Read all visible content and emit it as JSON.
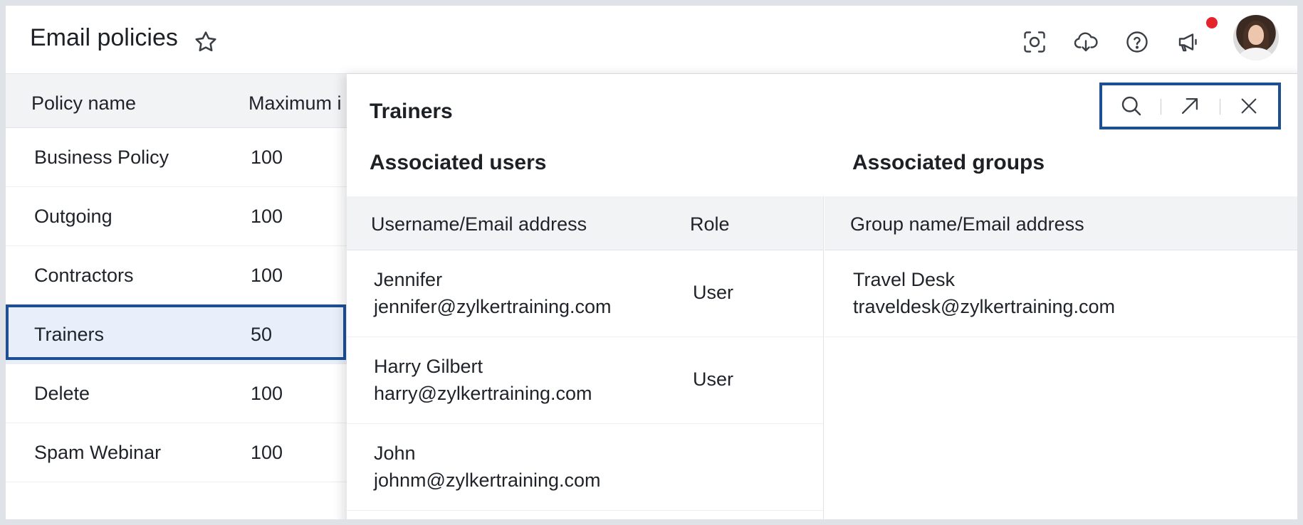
{
  "header": {
    "title": "Email policies",
    "icons": [
      "star-icon",
      "screenshot-icon",
      "cloud-download-icon",
      "help-icon",
      "announcement-icon",
      "avatar"
    ],
    "notification_color": "#e5232d"
  },
  "policies": {
    "columns": [
      "Policy name",
      "Maximum i"
    ],
    "rows": [
      {
        "name": "Business Policy",
        "max": "100"
      },
      {
        "name": "Outgoing",
        "max": "100"
      },
      {
        "name": "Contractors",
        "max": "100"
      },
      {
        "name": "Trainers",
        "max": "50"
      },
      {
        "name": "Delete",
        "max": "100"
      },
      {
        "name": "Spam Webinar",
        "max": "100"
      }
    ],
    "selected": "Trainers"
  },
  "panel": {
    "title": "Trainers",
    "tools": [
      "search-icon",
      "expand-icon",
      "close-icon"
    ],
    "users_section": "Associated users",
    "groups_section": "Associated groups",
    "users_columns": [
      "Username/Email address",
      "Role"
    ],
    "users": [
      {
        "name": "Jennifer",
        "email": "jennifer@zylkertraining.com",
        "role": "User"
      },
      {
        "name": "Harry Gilbert",
        "email": "harry@zylkertraining.com",
        "role": "User"
      },
      {
        "name": "John",
        "email": "johnm@zylkertraining.com",
        "role": ""
      }
    ],
    "groups_columns": [
      "Group name/Email address"
    ],
    "groups": [
      {
        "name": "Travel Desk",
        "email": "traveldesk@zylkertraining.com"
      }
    ]
  },
  "colors": {
    "highlight_border": "#1e4f92",
    "selected_row_bg": "#e8effb",
    "header_bg": "#f2f3f5"
  }
}
